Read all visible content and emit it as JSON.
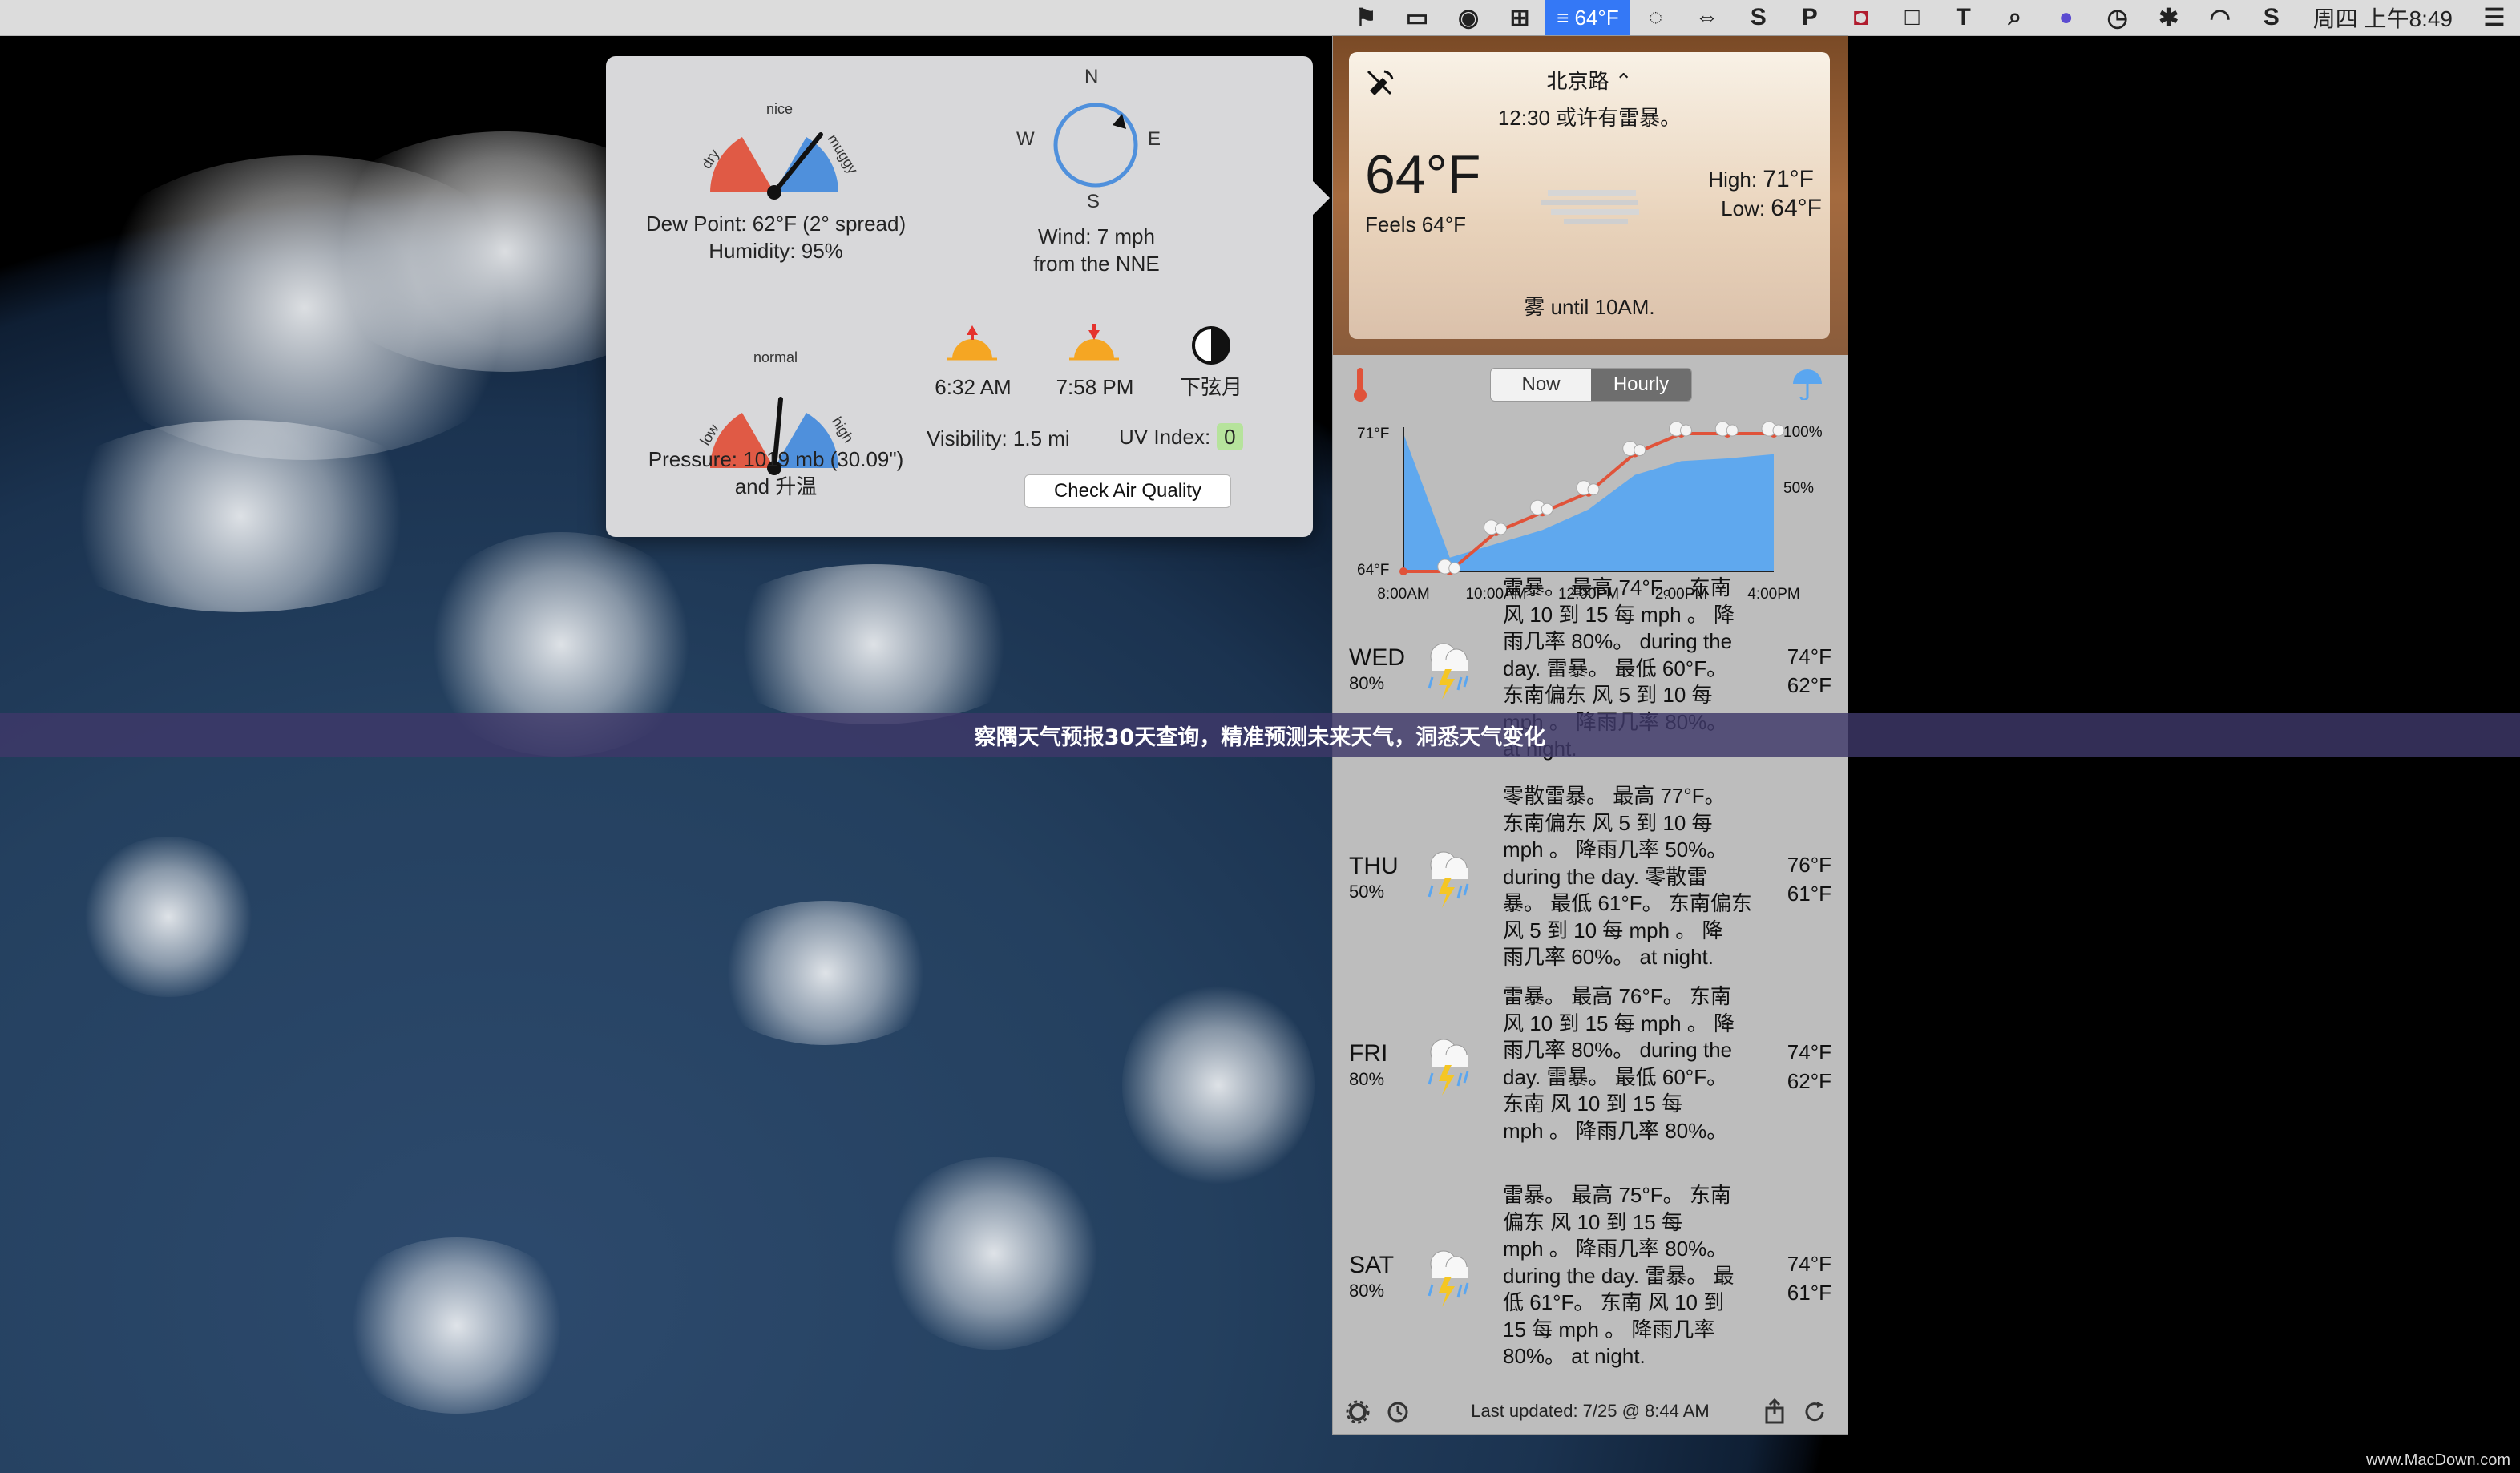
{
  "menubar": {
    "weather_temp": "64°F",
    "clock": "周四 上午8:49",
    "icons": [
      "bookmark-icon",
      "camera-icon",
      "mic-icon",
      "grid-icon",
      "weather-icon",
      "chat-icon",
      "teamviewer-icon",
      "s-icon",
      "p-icon",
      "shield-icon",
      "square-icon",
      "text-icon",
      "search-icon",
      "siri-icon",
      "time-machine-icon",
      "bluetooth-icon",
      "wifi-icon",
      "sogou-icon",
      "list-icon"
    ]
  },
  "detail": {
    "dew_gauge": {
      "label_left": "dry",
      "label_top": "nice",
      "label_right": "muggy",
      "level": 0.78
    },
    "dew_point": "Dew Point: 62°F (2° spread)",
    "humidity": "Humidity: 95%",
    "compass": {
      "n": "N",
      "s": "S",
      "e": "E",
      "w": "W",
      "direction": "NNE"
    },
    "wind_line1": "Wind: 7 mph",
    "wind_line2": "from the NNE",
    "pressure_gauge": {
      "label_left": "low",
      "label_top": "normal",
      "label_right": "high",
      "level": 0.55
    },
    "pressure_line1": "Pressure: 1019 mb (30.09\")",
    "pressure_line2": "and 升温",
    "sunrise": "6:32 AM",
    "sunset": "7:58 PM",
    "moon": "下弦月",
    "visibility": "Visibility: 1.5 mi",
    "uv_label": "UV Index:",
    "uv_value": "0",
    "air_button": "Check Air Quality"
  },
  "current": {
    "location": "北京路 ⌃",
    "alert": "12:30 或许有雷暴。",
    "temp": "64°F",
    "feels": "Feels 64°F",
    "high_label": "High:",
    "high": "71°F",
    "low_label": "Low:",
    "low": "64°F",
    "summary": "雾 until 10AM."
  },
  "tabs": {
    "now": "Now",
    "hourly": "Hourly"
  },
  "chart_data": {
    "type": "line",
    "x": [
      "8:00AM",
      "9:00AM",
      "10:00AM",
      "11:00AM",
      "12:00PM",
      "1:00PM",
      "2:00PM",
      "3:00PM",
      "4:00PM"
    ],
    "x_tick_labels": [
      "8:00AM",
      "10:00AM",
      "12:00PM",
      "2:00PM",
      "4:00PM"
    ],
    "series": [
      {
        "values": [
          64,
          64,
          66,
          67,
          68,
          70,
          71,
          71,
          71
        ]
      },
      {
        "values": [
          100,
          10,
          20,
          30,
          45,
          70,
          80,
          82,
          85
        ]
      }
    ],
    "y_left_labels": [
      "71°F",
      "64°F"
    ],
    "y_right_labels": [
      "100%",
      "50%"
    ],
    "ylim_temp": [
      64,
      71
    ],
    "ylim_precip": [
      0,
      100
    ],
    "colors": {
      "temp": "#e0533a",
      "precip": "#5aa6f0"
    }
  },
  "days": [
    {
      "name": "WED",
      "pct": "80%",
      "hi": "74°F",
      "lo": "62°F",
      "lines": [
        "雷暴。 最高 74°F。 东南",
        "风 10 到 15 每 mph 。 降",
        "雨几率 80%。 during the",
        "day. 雷暴。 最低 60°F。",
        "东南偏东 风 5 到 10 每",
        "mph 。 降雨几率 80%。",
        "at night."
      ]
    },
    {
      "name": "THU",
      "pct": "50%",
      "hi": "76°F",
      "lo": "61°F",
      "lines": [
        "零散雷暴。 最高 77°F。",
        "东南偏东 风 5 到 10 每",
        "mph 。 降雨几率 50%。",
        "during the day. 零散雷",
        "暴。 最低 61°F。 东南偏东",
        "风 5 到 10 每 mph 。 降",
        "雨几率 60%。 at night."
      ]
    },
    {
      "name": "FRI",
      "pct": "80%",
      "hi": "74°F",
      "lo": "62°F",
      "lines": [
        "雷暴。 最高 76°F。 东南",
        "风 10 到 15 每 mph 。 降",
        "雨几率 80%。 during the",
        "day. 雷暴。 最低 60°F。",
        "东南 风 10 到 15 每",
        "mph 。 降雨几率 80%。"
      ]
    },
    {
      "name": "SAT",
      "pct": "80%",
      "hi": "74°F",
      "lo": "61°F",
      "lines": [
        "雷暴。 最高 75°F。 东南",
        "偏东 风 10 到 15 每",
        "mph 。 降雨几率 80%。",
        "during the day. 雷暴。 最",
        "低 61°F。 东南 风 10 到",
        "15 每 mph 。 降雨几率",
        "80%。 at night."
      ]
    }
  ],
  "footer": {
    "last_updated": "Last updated: 7/25 @ 8:44 AM"
  },
  "banner": "察隅天气预报30天查询，精准预测未来天气，洞悉天气变化",
  "watermark": "www.MacDown.com"
}
